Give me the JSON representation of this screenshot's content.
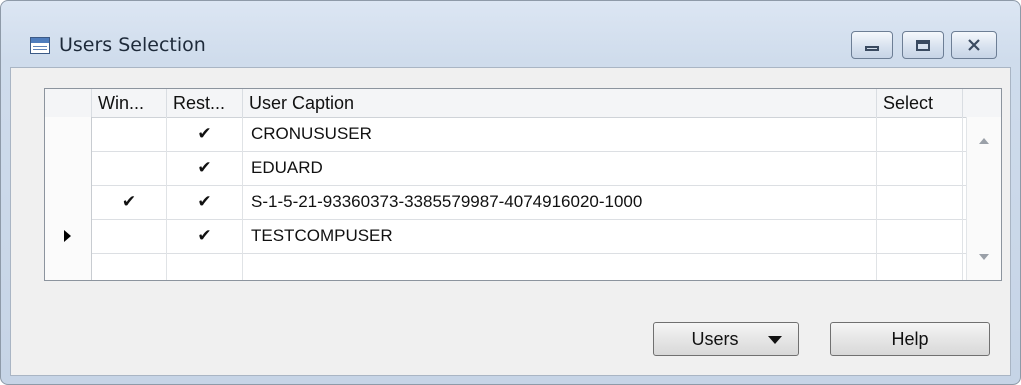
{
  "window": {
    "title": "Users Selection",
    "icon": "table-icon",
    "controls": [
      "minimize-icon",
      "maximize-icon",
      "close-icon"
    ]
  },
  "grid": {
    "columns": [
      "Win...",
      "Rest...",
      "User Caption",
      "Select"
    ],
    "rows": [
      {
        "win": "",
        "rest": "✔",
        "caption": "CRONUSUSER",
        "select": "",
        "current": false
      },
      {
        "win": "",
        "rest": "✔",
        "caption": "EDUARD",
        "select": "",
        "current": false
      },
      {
        "win": "✔",
        "rest": "✔",
        "caption": "S-1-5-21-93360373-3385579987-4074916020-1000",
        "select": "",
        "current": false
      },
      {
        "win": "",
        "rest": "✔",
        "caption": "TESTCOMPUSER",
        "select": "",
        "current": true
      },
      {
        "win": "",
        "rest": "",
        "caption": "",
        "select": "",
        "current": false
      }
    ]
  },
  "buttons": {
    "users_label": "Users",
    "help_label": "Help"
  }
}
